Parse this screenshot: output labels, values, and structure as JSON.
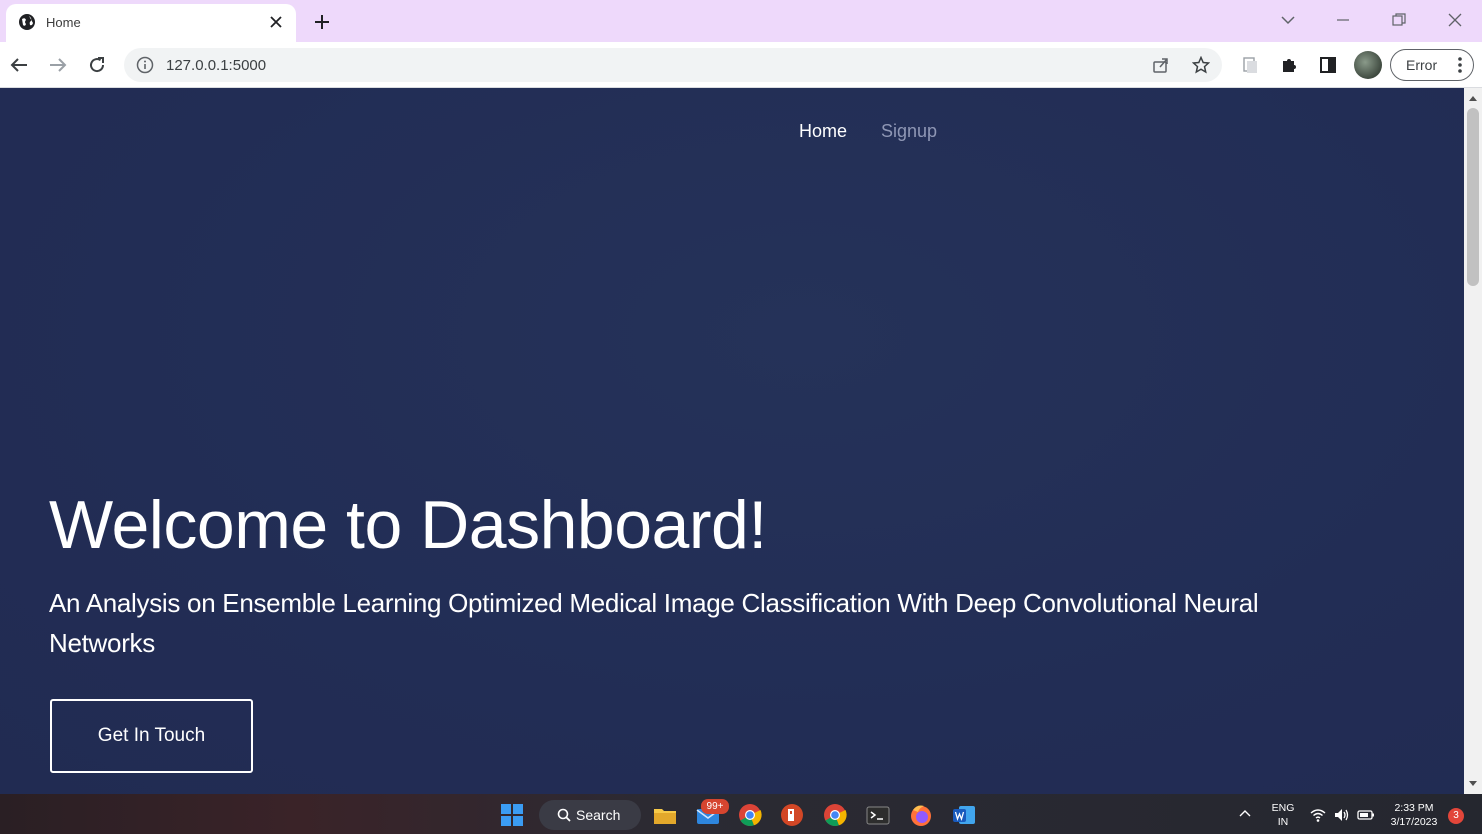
{
  "browser": {
    "tab_title": "Home",
    "url": "127.0.0.1:5000",
    "profile_status": "Error"
  },
  "page": {
    "nav": {
      "home": "Home",
      "signup": "Signup"
    },
    "hero_title": "Welcome to Dashboard!",
    "hero_subtitle": "An Analysis on Ensemble Learning Optimized Medical Image Classification With Deep Convolutional Neural Networks",
    "cta_label": "Get In Touch"
  },
  "taskbar": {
    "search_label": "Search",
    "mail_badge": "99+",
    "language": "ENG",
    "region": "IN",
    "time": "2:33 PM",
    "date": "3/17/2023",
    "notifications": "3"
  },
  "colors": {
    "page_bg": "#222d55",
    "tabstrip_bg": "#eed9fb",
    "nav_inactive": "#8f97b5"
  }
}
